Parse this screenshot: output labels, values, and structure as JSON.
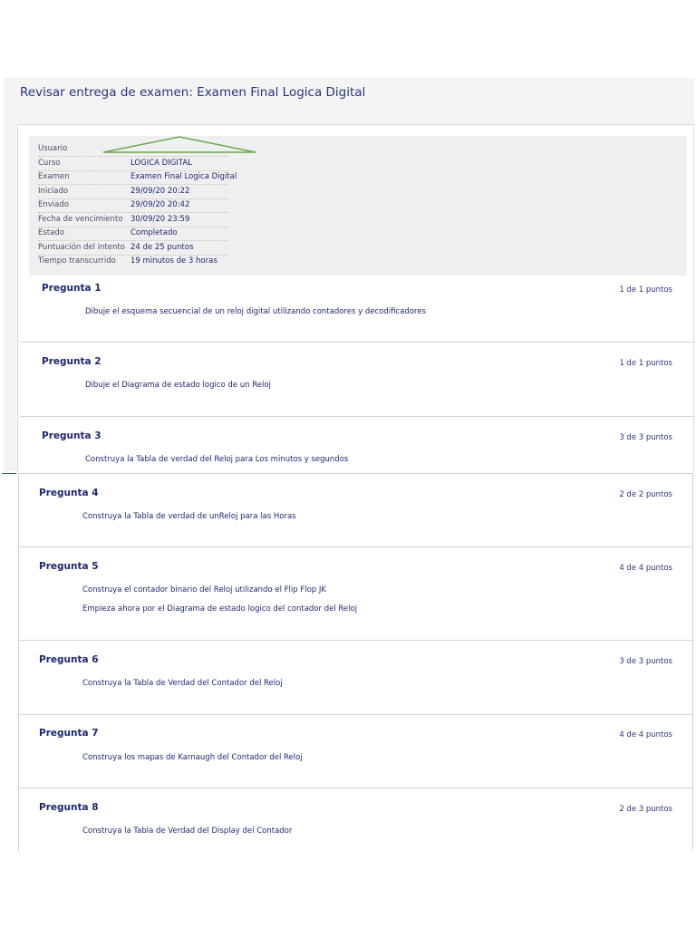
{
  "page": {
    "title": "Revisar entrega de examen: Examen Final Logica Digital"
  },
  "details": [
    {
      "label": "Usuario",
      "value": ""
    },
    {
      "label": "Curso",
      "value": "LOGICA DIGITAL"
    },
    {
      "label": "Examen",
      "value": "Examen Final Logica Digital"
    },
    {
      "label": "Iniciado",
      "value": "29/09/20 20:22"
    },
    {
      "label": "Enviado",
      "value": "29/09/20 20:42"
    },
    {
      "label": "Fecha de vencimiento",
      "value": "30/09/20 23:59"
    },
    {
      "label": "Estado",
      "value": "Completado"
    },
    {
      "label": "Puntuación del intento",
      "value": "24 de 25 puntos"
    },
    {
      "label": "Tiempo transcurrido",
      "value": "19 minutos de 3 horas"
    }
  ],
  "questions": [
    {
      "title": "Pregunta 1",
      "points": "1 de 1 puntos",
      "lines": [
        "Dibuje el esquema secuencial de un reloj digital utilizando contadores y decodificadores"
      ]
    },
    {
      "title": "Pregunta 2",
      "points": "1 de 1 puntos",
      "lines": [
        "Dibuje el Diagrama de estado logico de un Reloj"
      ]
    },
    {
      "title": "Pregunta 3",
      "points": "3 de 3 puntos",
      "lines": [
        "Construya la Tabla de verdad del Reloj para Los minutos y segundos"
      ]
    },
    {
      "title": "Pregunta 4",
      "points": "2 de 2 puntos",
      "lines": [
        "Construya la Tabla de verdad de unReloj para las Horas"
      ]
    },
    {
      "title": "Pregunta 5",
      "points": "4 de 4 puntos",
      "lines": [
        "Construya el contador binario del Reloj utilizando el Flip Flop JK",
        "Empieza ahora por el Diagrama de estado logico del contador del Reloj"
      ]
    },
    {
      "title": "Pregunta 6",
      "points": "3 de 3 puntos",
      "lines": [
        "Construya la Tabla de Verdad del Contador del Reloj"
      ]
    },
    {
      "title": "Pregunta 7",
      "points": "4 de 4 puntos",
      "lines": [
        "Construya los mapas de Karnaugh del Contador del Reloj"
      ]
    },
    {
      "title": "Pregunta 8",
      "points": "2 de 3 puntos",
      "lines": [
        "Construya la Tabla de Verdad del Display del Contador"
      ]
    }
  ],
  "colors": {
    "annotation": "#6aa84f",
    "text": "#1e2870"
  }
}
